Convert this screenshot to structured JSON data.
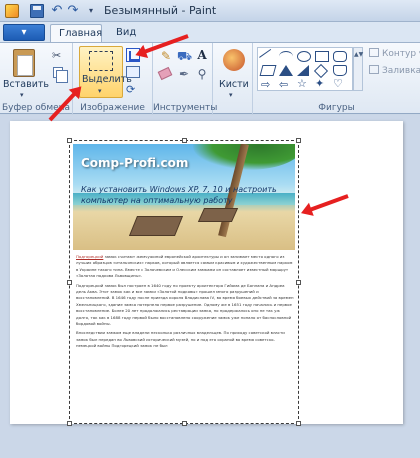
{
  "window": {
    "title": "Безымянный - Paint",
    "quick_access": {
      "undo": "↶",
      "redo": "↷",
      "dropdown": "▾"
    }
  },
  "ribbon": {
    "file_button_label": "▾",
    "tabs": [
      {
        "label": "Главная",
        "active": true
      },
      {
        "label": "Вид",
        "active": false
      }
    ],
    "groups": {
      "clipboard": {
        "label": "Буфер обмена",
        "paste_label": "Вставить",
        "dropdown": "▾",
        "cut_icon": "✂"
      },
      "image": {
        "label": "Изображение",
        "select_label": "Выделить",
        "dropdown": "▾",
        "rotate_icon": "⟳"
      },
      "tools": {
        "label": "Инструменты",
        "pencil_icon": "✎",
        "fill_icon": "⛟",
        "text_icon": "A",
        "picker_icon": "✒",
        "magnifier_icon": "⚲"
      },
      "brushes": {
        "label": "Кисти",
        "dropdown": "▾"
      },
      "shapes": {
        "label": "Фигуры",
        "outline_label": "Контур ▾",
        "fill_label": "Заливка ▾",
        "scroll": "▲▼",
        "glyph_arrow": "⇨",
        "glyph_arrow2": "⇦",
        "glyph_star": "☆",
        "glyph_star2": "✦",
        "glyph_heart": "♡"
      }
    }
  },
  "canvas": {
    "image_title": "Comp-Profi.com",
    "image_caption": "Как установить Windows XP, 7, 10 и настроить компьютер на оптимальную работу",
    "article": [
      {
        "lead": "Подгорецкий",
        "text": " замок считают жемчужиной европейской архитектуры и он занимает место одного из лучших образцов «итальянских» парков, который является самым красивым и художественным парком в Украине такого типа. Вместе с Золочевским и Олесским замками он составляет известный маршрут «Золотая подкова Львовщины»."
      },
      {
        "lead": "",
        "text": "Подгорецкий замок был построен в 1640 году по проекту архитектора Гийома де Боплана и Андреа дель Аква. Этот замок как и все замки «Золотой подковы» прошел много разрушений и восстановлений. В 1646 году после приезда короля Владислава IV, во время боевых действий за времен Хмельницкого, здание замка потерпело первое разрушение. Одному же в 1651 году начались и первое восстановление. Более 20 лет продолжались реставрации замка, но продержалось оно не так уж долго, так как в 1688 году первой было восстановлено сооружение замок уже попало от баснословной бордовой войны."
      },
      {
        "lead": "",
        "text": "Впоследствии замком еще владели несколько различных владельцев. По приходу советской власти замок был передан во Львовский исторический музей, но и под его охраной во время советско-немецкой войны Подгорецкий замок не был"
      }
    ]
  },
  "colors": {
    "ribbon_active": "#ffd36b",
    "annotation_arrow": "#e62020",
    "selection_border": "#3a3a3a"
  }
}
